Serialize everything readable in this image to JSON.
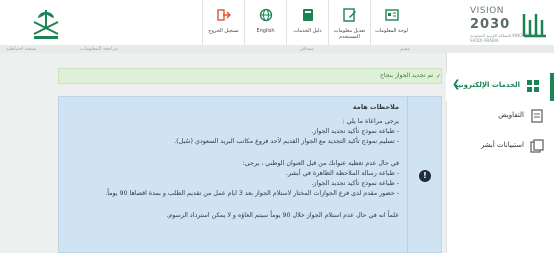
{
  "header": {
    "vision_label": "VISION",
    "vision_arabic": "رؤية",
    "vision_year": "2030",
    "vision_sub": "المملكة العربية السعودية KINGDOM OF SAUDI ARABIA",
    "toolbar": [
      {
        "label": "لوحة المعلومات",
        "icon": "dashboard-icon"
      },
      {
        "label": "تعديل معلومات المستخدم",
        "icon": "edit-profile-icon"
      },
      {
        "label": "دليل الخدمات",
        "icon": "services-guide-icon"
      },
      {
        "label": "English",
        "icon": "globe-icon"
      },
      {
        "label": "تسجيل الخروج",
        "icon": "logout-icon"
      }
    ],
    "subbar": [
      "نسخة احتياطية",
      "مراجعة المعلومات",
      "مسافر",
      "مقيم"
    ],
    "accent": "#1b8354"
  },
  "sidebar": {
    "items": [
      {
        "label": "الخدمات الإلكترونية",
        "icon": "grid-icon",
        "active": true
      },
      {
        "label": "التفاويض",
        "icon": "document-icon",
        "active": false
      },
      {
        "label": "استبيانات أبشر",
        "icon": "survey-icon",
        "active": false
      }
    ]
  },
  "main": {
    "success_message": "تم تجديد الجواز بنجاح",
    "notice": {
      "title": "ملاحظات هامة",
      "lines_a": [
        "يرجى مراعاة ما يلي :",
        "- طباعة نموذج تأكيد تجديد الجواز.",
        "- تسليم نموذج تأكيد التجديد مع الجواز القديم لأحد فروع مكاتب البريد السعودي (سُبل)."
      ],
      "lines_b": [
        "في حال عدم تغطية عنوانك من قبل العنوان الوطني ، يرجى:",
        "- طباعة رسالة الملاحظة الظاهرة في أبشر.",
        "- طباعة نموذج تأكيد تجديد الجواز.",
        "- حضور مقدم لدى فرع الجوازات المختار لاستلام الجواز بعد 3 ايام عمل من تقديم الطلب و بمدة اقصاها 90 يوماً."
      ],
      "lines_c": [
        "علماً انه في حال عدم استلام الجواز خلال 90 يوماً سيتم الغاؤه و لا يمكن استرداد الرسوم."
      ]
    }
  }
}
